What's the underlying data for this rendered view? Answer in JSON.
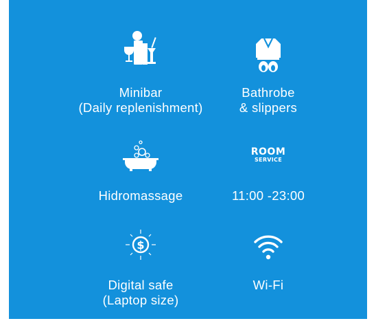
{
  "colors": {
    "panel_bg": "#1391dc",
    "icon": "#ffffff",
    "text": "#ffffff"
  },
  "amenities": [
    {
      "icon": "minibar-icon",
      "lines": [
        "Minibar",
        "(Daily replenishment)"
      ]
    },
    {
      "icon": "bathrobe-slippers-icon",
      "lines": [
        "Bathrobe",
        "& slippers"
      ]
    },
    {
      "icon": "bathtub-bubbles-icon",
      "lines": [
        "Hidromassage"
      ]
    },
    {
      "icon": "room-service-icon",
      "icon_text": [
        "ROOM",
        "SERVICE"
      ],
      "lines": [
        "11:00 -23:00"
      ]
    },
    {
      "icon": "safe-icon",
      "lines": [
        "Digital safe",
        "(Laptop size)"
      ]
    },
    {
      "icon": "wifi-icon",
      "lines": [
        "Wi-Fi"
      ]
    }
  ]
}
